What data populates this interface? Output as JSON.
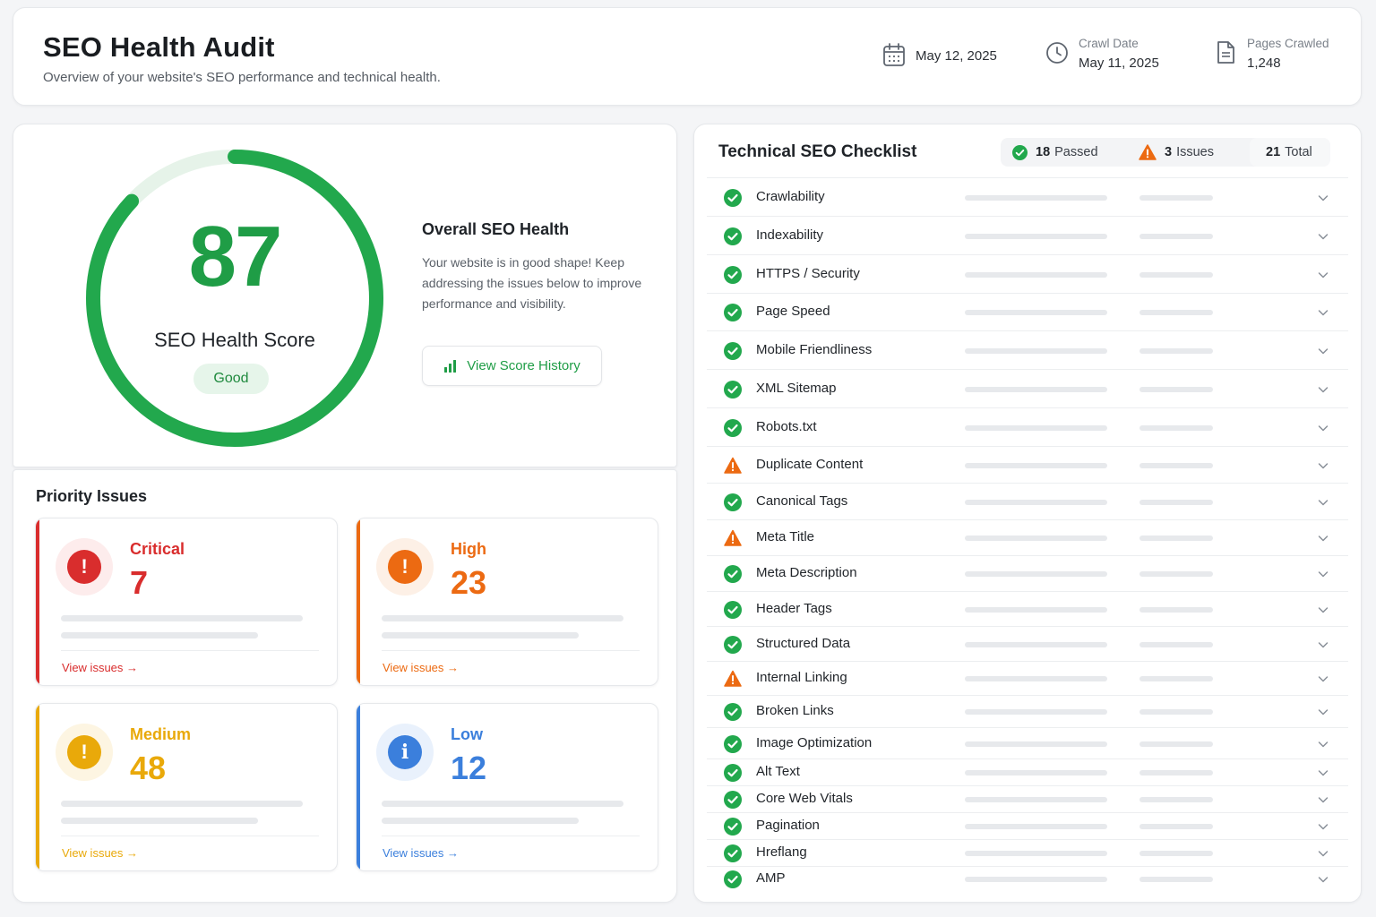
{
  "header": {
    "title": "SEO Health Audit",
    "subtitle": "Overview of your website's SEO performance and technical health.",
    "report_date": "May 12, 2025",
    "crawl_label": "Crawl Date",
    "crawl_value": "May 11, 2025",
    "pages_label": "Pages Crawled",
    "pages_value": "1,248",
    "icons": [
      "calendar-icon",
      "clock-icon",
      "document-icon"
    ]
  },
  "score": {
    "value": "87",
    "fraction": 0.87,
    "label": "SEO Health Score",
    "badge": "Good",
    "color": "#22a84d",
    "track_color": "#e6f3e9"
  },
  "overall": {
    "title": "Overall SEO Health",
    "text": "Your website is in good shape! Keep addressing the issues below to improve performance and visibility.",
    "history_label": "View Score History",
    "history_icon": "bar-chart-icon"
  },
  "priority": {
    "title": "Priority Issues",
    "link_label": "View issues →",
    "items": [
      {
        "label": "Critical",
        "count": "7",
        "color": "#d92d2d",
        "halo": "#fdecec",
        "icon": "exclamation-icon"
      },
      {
        "label": "High",
        "count": "23",
        "color": "#ec6a12",
        "halo": "#fdf0e6",
        "icon": "exclamation-icon"
      },
      {
        "label": "Medium",
        "count": "48",
        "color": "#e9a90a",
        "halo": "#fdf5e2",
        "icon": "exclamation-icon"
      },
      {
        "label": "Low",
        "count": "12",
        "color": "#3b7fdc",
        "halo": "#e9f1fc",
        "icon": "info-icon"
      }
    ]
  },
  "checklist": {
    "title": "Technical SEO Checklist",
    "passed_count": "18",
    "passed_label": "Passed",
    "issues_count": "3",
    "issues_label": "Issues",
    "total_count": "21",
    "total_label": "Total",
    "pass_color": "#22a84d",
    "warn_color": "#ec6a12",
    "items": [
      {
        "name": "Crawlability",
        "status": "pass"
      },
      {
        "name": "Indexability",
        "status": "pass"
      },
      {
        "name": "HTTPS / Security",
        "status": "pass"
      },
      {
        "name": "Page Speed",
        "status": "pass"
      },
      {
        "name": "Mobile Friendliness",
        "status": "pass"
      },
      {
        "name": "XML Sitemap",
        "status": "pass"
      },
      {
        "name": "Robots.txt",
        "status": "pass"
      },
      {
        "name": "Duplicate Content",
        "status": "warn"
      },
      {
        "name": "Canonical Tags",
        "status": "pass"
      },
      {
        "name": "Meta Title",
        "status": "warn"
      },
      {
        "name": "Meta Description",
        "status": "pass"
      },
      {
        "name": "Header Tags",
        "status": "pass"
      },
      {
        "name": "Structured Data",
        "status": "pass"
      },
      {
        "name": "Internal Linking",
        "status": "warn"
      },
      {
        "name": "Broken Links",
        "status": "pass"
      },
      {
        "name": "Image Optimization",
        "status": "pass"
      },
      {
        "name": "Alt Text",
        "status": "pass"
      },
      {
        "name": "Core Web Vitals",
        "status": "pass"
      },
      {
        "name": "Pagination",
        "status": "pass"
      },
      {
        "name": "Hreflang",
        "status": "pass"
      },
      {
        "name": "AMP",
        "status": "pass"
      }
    ]
  }
}
